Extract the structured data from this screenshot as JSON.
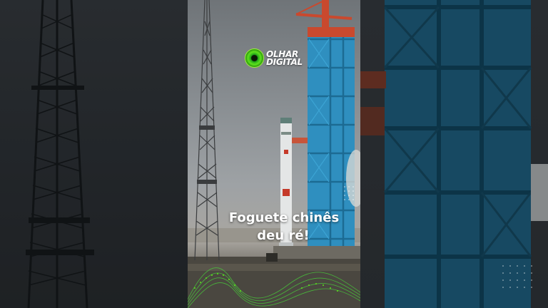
{
  "brand": {
    "line1": "OLHAR",
    "line2": "DIGITAL"
  },
  "caption": {
    "line1": "Foguete chinês",
    "line2": "deu ré!"
  },
  "colors": {
    "tower": "#2f8fbf",
    "accent": "#5fe21b",
    "crane": "#c9492e"
  }
}
